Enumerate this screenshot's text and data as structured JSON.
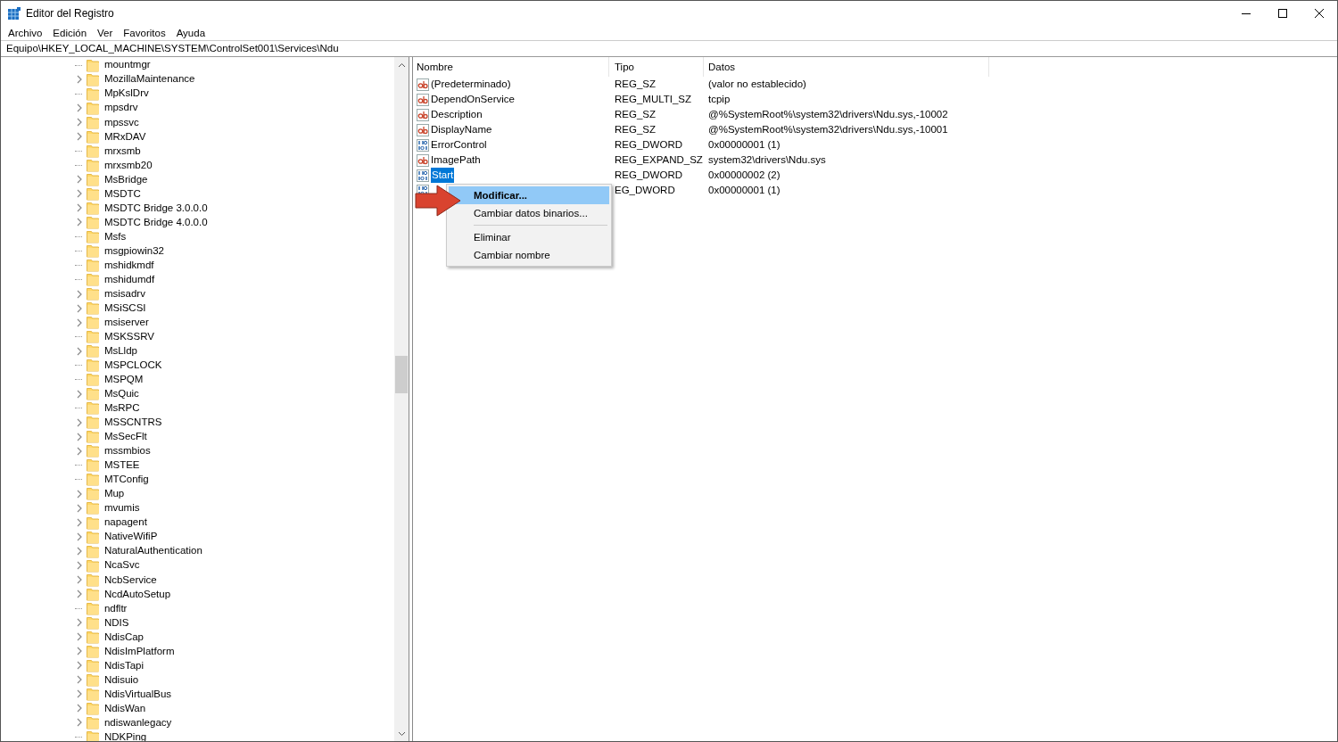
{
  "window": {
    "title": "Editor del Registro"
  },
  "menu": [
    "Archivo",
    "Edición",
    "Ver",
    "Favoritos",
    "Ayuda"
  ],
  "address": "Equipo\\HKEY_LOCAL_MACHINE\\SYSTEM\\ControlSet001\\Services\\Ndu",
  "tree": [
    {
      "label": "mountmgr",
      "expandable": false
    },
    {
      "label": "MozillaMaintenance",
      "expandable": true
    },
    {
      "label": "MpKslDrv",
      "expandable": false
    },
    {
      "label": "mpsdrv",
      "expandable": true
    },
    {
      "label": "mpssvc",
      "expandable": true
    },
    {
      "label": "MRxDAV",
      "expandable": true
    },
    {
      "label": "mrxsmb",
      "expandable": false
    },
    {
      "label": "mrxsmb20",
      "expandable": false
    },
    {
      "label": "MsBridge",
      "expandable": true
    },
    {
      "label": "MSDTC",
      "expandable": true
    },
    {
      "label": "MSDTC Bridge 3.0.0.0",
      "expandable": true
    },
    {
      "label": "MSDTC Bridge 4.0.0.0",
      "expandable": true
    },
    {
      "label": "Msfs",
      "expandable": false
    },
    {
      "label": "msgpiowin32",
      "expandable": false
    },
    {
      "label": "mshidkmdf",
      "expandable": false
    },
    {
      "label": "mshidumdf",
      "expandable": false
    },
    {
      "label": "msisadrv",
      "expandable": true
    },
    {
      "label": "MSiSCSI",
      "expandable": true
    },
    {
      "label": "msiserver",
      "expandable": true
    },
    {
      "label": "MSKSSRV",
      "expandable": false
    },
    {
      "label": "MsLldp",
      "expandable": true
    },
    {
      "label": "MSPCLOCK",
      "expandable": false
    },
    {
      "label": "MSPQM",
      "expandable": false
    },
    {
      "label": "MsQuic",
      "expandable": true
    },
    {
      "label": "MsRPC",
      "expandable": false
    },
    {
      "label": "MSSCNTRS",
      "expandable": true
    },
    {
      "label": "MsSecFlt",
      "expandable": true
    },
    {
      "label": "mssmbios",
      "expandable": true
    },
    {
      "label": "MSTEE",
      "expandable": false
    },
    {
      "label": "MTConfig",
      "expandable": false
    },
    {
      "label": "Mup",
      "expandable": true
    },
    {
      "label": "mvumis",
      "expandable": true
    },
    {
      "label": "napagent",
      "expandable": true
    },
    {
      "label": "NativeWifiP",
      "expandable": true
    },
    {
      "label": "NaturalAuthentication",
      "expandable": true
    },
    {
      "label": "NcaSvc",
      "expandable": true
    },
    {
      "label": "NcbService",
      "expandable": true
    },
    {
      "label": "NcdAutoSetup",
      "expandable": true
    },
    {
      "label": "ndfltr",
      "expandable": false
    },
    {
      "label": "NDIS",
      "expandable": true
    },
    {
      "label": "NdisCap",
      "expandable": true
    },
    {
      "label": "NdisImPlatform",
      "expandable": true
    },
    {
      "label": "NdisTapi",
      "expandable": true
    },
    {
      "label": "Ndisuio",
      "expandable": true
    },
    {
      "label": "NdisVirtualBus",
      "expandable": true
    },
    {
      "label": "NdisWan",
      "expandable": true
    },
    {
      "label": "ndiswanlegacy",
      "expandable": true
    },
    {
      "label": "NDKPing",
      "expandable": false
    }
  ],
  "table": {
    "columns": [
      "Nombre",
      "Tipo",
      "Datos"
    ],
    "rows": [
      {
        "kind": "string",
        "name": "(Predeterminado)",
        "type": "REG_SZ",
        "data": "(valor no establecido)",
        "selected": false
      },
      {
        "kind": "string",
        "name": "DependOnService",
        "type": "REG_MULTI_SZ",
        "data": "tcpip",
        "selected": false
      },
      {
        "kind": "string",
        "name": "Description",
        "type": "REG_SZ",
        "data": "@%SystemRoot%\\system32\\drivers\\Ndu.sys,-10002",
        "selected": false
      },
      {
        "kind": "string",
        "name": "DisplayName",
        "type": "REG_SZ",
        "data": "@%SystemRoot%\\system32\\drivers\\Ndu.sys,-10001",
        "selected": false
      },
      {
        "kind": "binary",
        "name": "ErrorControl",
        "type": "REG_DWORD",
        "data": "0x00000001 (1)",
        "selected": false
      },
      {
        "kind": "string",
        "name": "ImagePath",
        "type": "REG_EXPAND_SZ",
        "data": "system32\\drivers\\Ndu.sys",
        "selected": false
      },
      {
        "kind": "binary",
        "name": "Start",
        "type": "REG_DWORD",
        "data": "0x00000002 (2)",
        "selected": true
      },
      {
        "kind": "binary",
        "type": "EG_DWORD",
        "data": "0x00000001 (1)",
        "selected": false
      }
    ]
  },
  "context_menu": [
    {
      "kind": "item",
      "label": "Modificar...",
      "selected": true
    },
    {
      "kind": "item",
      "label": "Cambiar datos binarios...",
      "selected": false
    },
    {
      "kind": "separator"
    },
    {
      "kind": "item",
      "label": "Eliminar",
      "selected": false
    },
    {
      "kind": "item",
      "label": "Cambiar nombre",
      "selected": false
    }
  ]
}
